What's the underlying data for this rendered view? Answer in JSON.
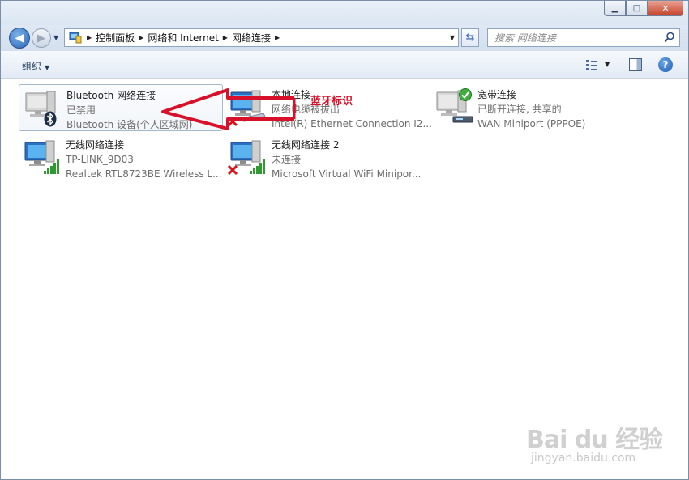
{
  "window": {
    "caption_buttons": {
      "minimize": "▁",
      "maximize": "□",
      "close": "✕"
    }
  },
  "nav": {
    "breadcrumb": [
      "控制面板",
      "网络和 Internet",
      "网络连接"
    ],
    "search_placeholder": "搜索 网络连接"
  },
  "toolbar": {
    "organize_label": "组织"
  },
  "connections": [
    {
      "name": "Bluetooth 网络连接",
      "status": "已禁用",
      "device": "Bluetooth 设备(个人区域网)",
      "overlay": "bluetooth-icon",
      "selected": true
    },
    {
      "name": "本地连接",
      "status": "网络电缆被拔出",
      "device": "Intel(R) Ethernet Connection I2...",
      "overlay": "red-x-icon",
      "selected": false
    },
    {
      "name": "宽带连接",
      "status": "已断开连接, 共享的",
      "device": "WAN Miniport (PPPOE)",
      "overlay": "green-check-icon",
      "selected": false
    },
    {
      "name": "无线网络连接",
      "status": "TP-LINK_9D03",
      "device": "Realtek RTL8723BE Wireless L...",
      "overlay": "signal-bars-icon",
      "selected": false
    },
    {
      "name": "无线网络连接 2",
      "status": "未连接",
      "device": "Microsoft Virtual WiFi Minipor...",
      "overlay": "red-x-signal-icon",
      "selected": false
    }
  ],
  "annotation": {
    "text": "蓝牙标识",
    "color": "#d8102a"
  },
  "watermark": {
    "main": "Bai du 经验",
    "url": "jingyan.baidu.com"
  },
  "colors": {
    "accent": "#2a62b8",
    "annotation": "#d8102a",
    "status_text": "#6d6d6d"
  }
}
